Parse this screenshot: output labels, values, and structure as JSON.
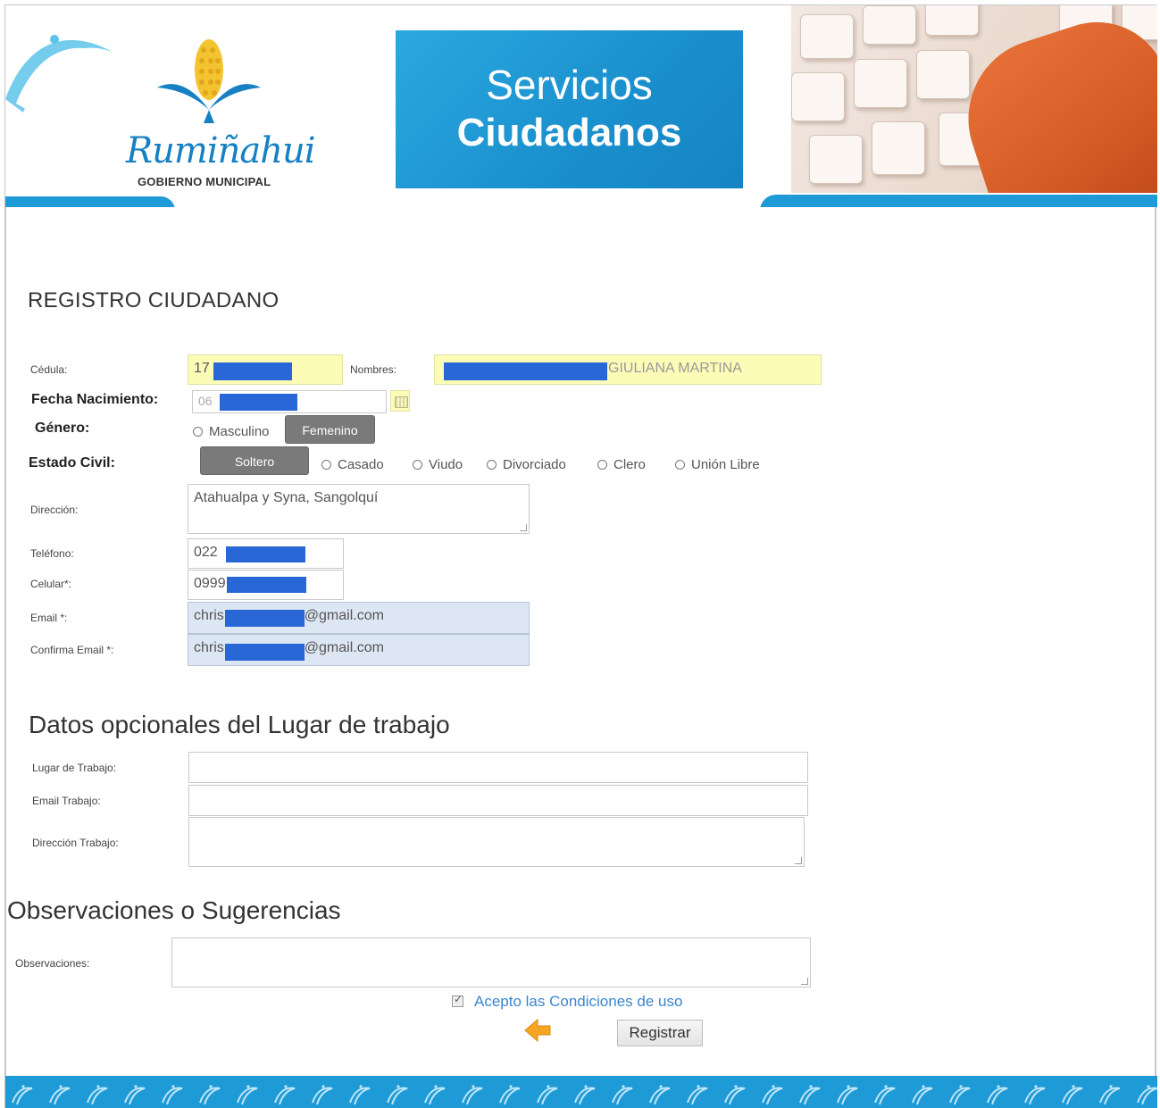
{
  "header": {
    "logo_name": "Rumiñahui",
    "logo_subtitle": "GOBIERNO MUNICIPAL",
    "banner_line1": "Servicios",
    "banner_line2": "Ciudadanos"
  },
  "page_title": "REGISTRO CIUDADANO",
  "form": {
    "cedula_label": "Cédula:",
    "cedula_value": "17",
    "nombres_label": "Nombres:",
    "nombres_value": "GIULIANA MARTINA",
    "fecha_label": "Fecha Nacimiento:",
    "fecha_value": "06",
    "genero_label": "Género:",
    "genero_options": [
      "Masculino",
      "Femenino"
    ],
    "genero_selected": "Femenino",
    "estado_label": "Estado Civil:",
    "estado_options": [
      "Soltero",
      "Casado",
      "Viudo",
      "Divorciado",
      "Clero",
      "Unión Libre"
    ],
    "estado_selected": "Soltero",
    "direccion_label": "Dirección:",
    "direccion_value": "Atahualpa y Syna, Sangolquí",
    "telefono_label": "Teléfono:",
    "telefono_value": "022",
    "celular_label": "Celular*:",
    "celular_value": "0999",
    "email_label": "Email *:",
    "email_prefix": "chris",
    "email_suffix": "@gmail.com",
    "confirma_label": "Confirma Email *:",
    "confirma_prefix": "chris",
    "confirma_suffix": "@gmail.com"
  },
  "work": {
    "title": "Datos opcionales del Lugar de trabajo",
    "lugar_label": "Lugar de Trabajo:",
    "email_label": "Email Trabajo:",
    "direccion_label": "Dirección Trabajo:"
  },
  "obs": {
    "title": "Observaciones o Sugerencias",
    "label": "Observaciones:"
  },
  "terms_label": "Acepto las Condiciones de uso",
  "register_label": "Registrar",
  "colors": {
    "brand_blue": "#1e9ad6",
    "highlight_yellow": "#fcfcb7",
    "autofill_blue": "#dde6f3",
    "selected_gray": "#7a7a7a",
    "link_blue": "#3b86cf"
  }
}
